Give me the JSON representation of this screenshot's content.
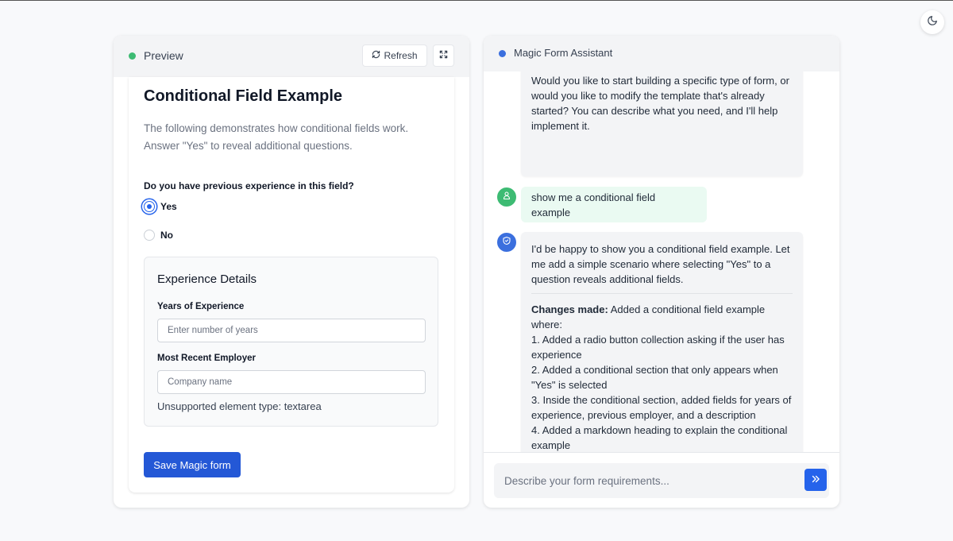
{
  "preview": {
    "title": "Preview",
    "refresh_label": "Refresh",
    "form": {
      "title": "Conditional Field Example",
      "description": "The following demonstrates how conditional fields work. Answer \"Yes\" to reveal additional questions.",
      "question": "Do you have previous experience in this field?",
      "options": [
        "Yes",
        "No"
      ],
      "selected": "Yes",
      "details": {
        "title": "Experience Details",
        "years_label": "Years of Experience",
        "years_placeholder": "Enter number of years",
        "employer_label": "Most Recent Employer",
        "employer_placeholder": "Company name",
        "unsupported_text": "Unsupported element type: textarea"
      },
      "save_label": "Save Magic form"
    }
  },
  "chat": {
    "title": "Magic Form Assistant",
    "messages": [
      {
        "role": "assistant",
        "text": "Would you like to start building a specific type of form, or would you like to modify the template that's already started? You can describe what you need, and I'll help implement it."
      },
      {
        "role": "user",
        "text": "show me a conditional field example"
      },
      {
        "role": "assistant",
        "intro": "I'd be happy to show you a conditional field example. Let me add a simple scenario where selecting \"Yes\" to a question reveals additional fields.",
        "changes_label": "Changes made:",
        "changes_text": " Added a conditional field example where:",
        "items": [
          "1. Added a radio button collection asking if the user has experience",
          "2. Added a conditional section that only appears when \"Yes\" is selected",
          "3. Inside the conditional section, added fields for years of experience, previous employer, and a description",
          "4. Added a markdown heading to explain the conditional example"
        ]
      }
    ],
    "input_placeholder": "Describe your form requirements..."
  },
  "colors": {
    "accent": "#2563eb",
    "preview_status": "#3dbb73",
    "assistant_status": "#3b6fde",
    "user_bubble": "#eafaf2"
  },
  "icons": {
    "theme": "moon-icon",
    "refresh": "refresh-icon",
    "expand": "expand-icon",
    "user_avatar": "user-icon",
    "bot_avatar": "shield-icon",
    "send": "double-chevron-right-icon"
  }
}
